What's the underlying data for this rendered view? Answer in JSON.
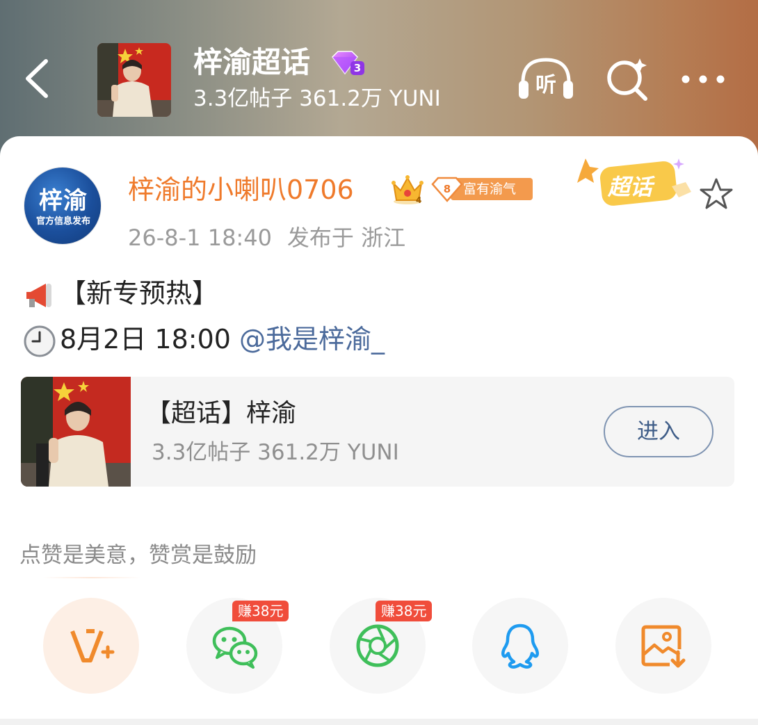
{
  "header": {
    "title": "梓渝超话",
    "level": "3",
    "stats": "3.3亿帖子 361.2万 YUNI",
    "listen_label": "听",
    "icons": {
      "back": "back-arrow-icon",
      "listen": "headphones-listen-icon",
      "search": "search-sparkle-icon",
      "more": "more-dots-icon"
    }
  },
  "post": {
    "author": {
      "name": "梓渝的小喇叭0706",
      "avatar_text": "梓渝",
      "avatar_subtext": "官方信息发布",
      "crown_level": "4",
      "fan_level": "8",
      "fan_title": "富有渝气"
    },
    "chaohua_badge": "超话",
    "meta": {
      "time": "26-8-1 18:40",
      "location": "发布于 浙江"
    },
    "lines": [
      {
        "icon": "megaphone-icon",
        "text": "【新专预热】"
      },
      {
        "icon": "clock-icon",
        "text": "8月2日 18:00 ",
        "mention": "@我是梓渝_"
      }
    ]
  },
  "topic_card": {
    "title": "【超话】梓渝",
    "stats": "3.3亿帖子 361.2万 YUNI",
    "enter_label": "进入"
  },
  "reward_hint": "点赞是美意，赞赏是鼓励",
  "share": {
    "items": [
      {
        "icon": "v-plus-icon",
        "badge": ""
      },
      {
        "icon": "wechat-icon",
        "badge": "赚38元"
      },
      {
        "icon": "moments-icon",
        "badge": "赚38元"
      },
      {
        "icon": "qq-icon",
        "badge": ""
      },
      {
        "icon": "save-image-icon",
        "badge": ""
      }
    ]
  },
  "colors": {
    "accent_orange": "#ef7a2b",
    "link_blue": "#4b6a9b",
    "earn_red": "#f04d3b",
    "wechat_green": "#3fbf5a",
    "qq_blue": "#1e9bf0"
  }
}
